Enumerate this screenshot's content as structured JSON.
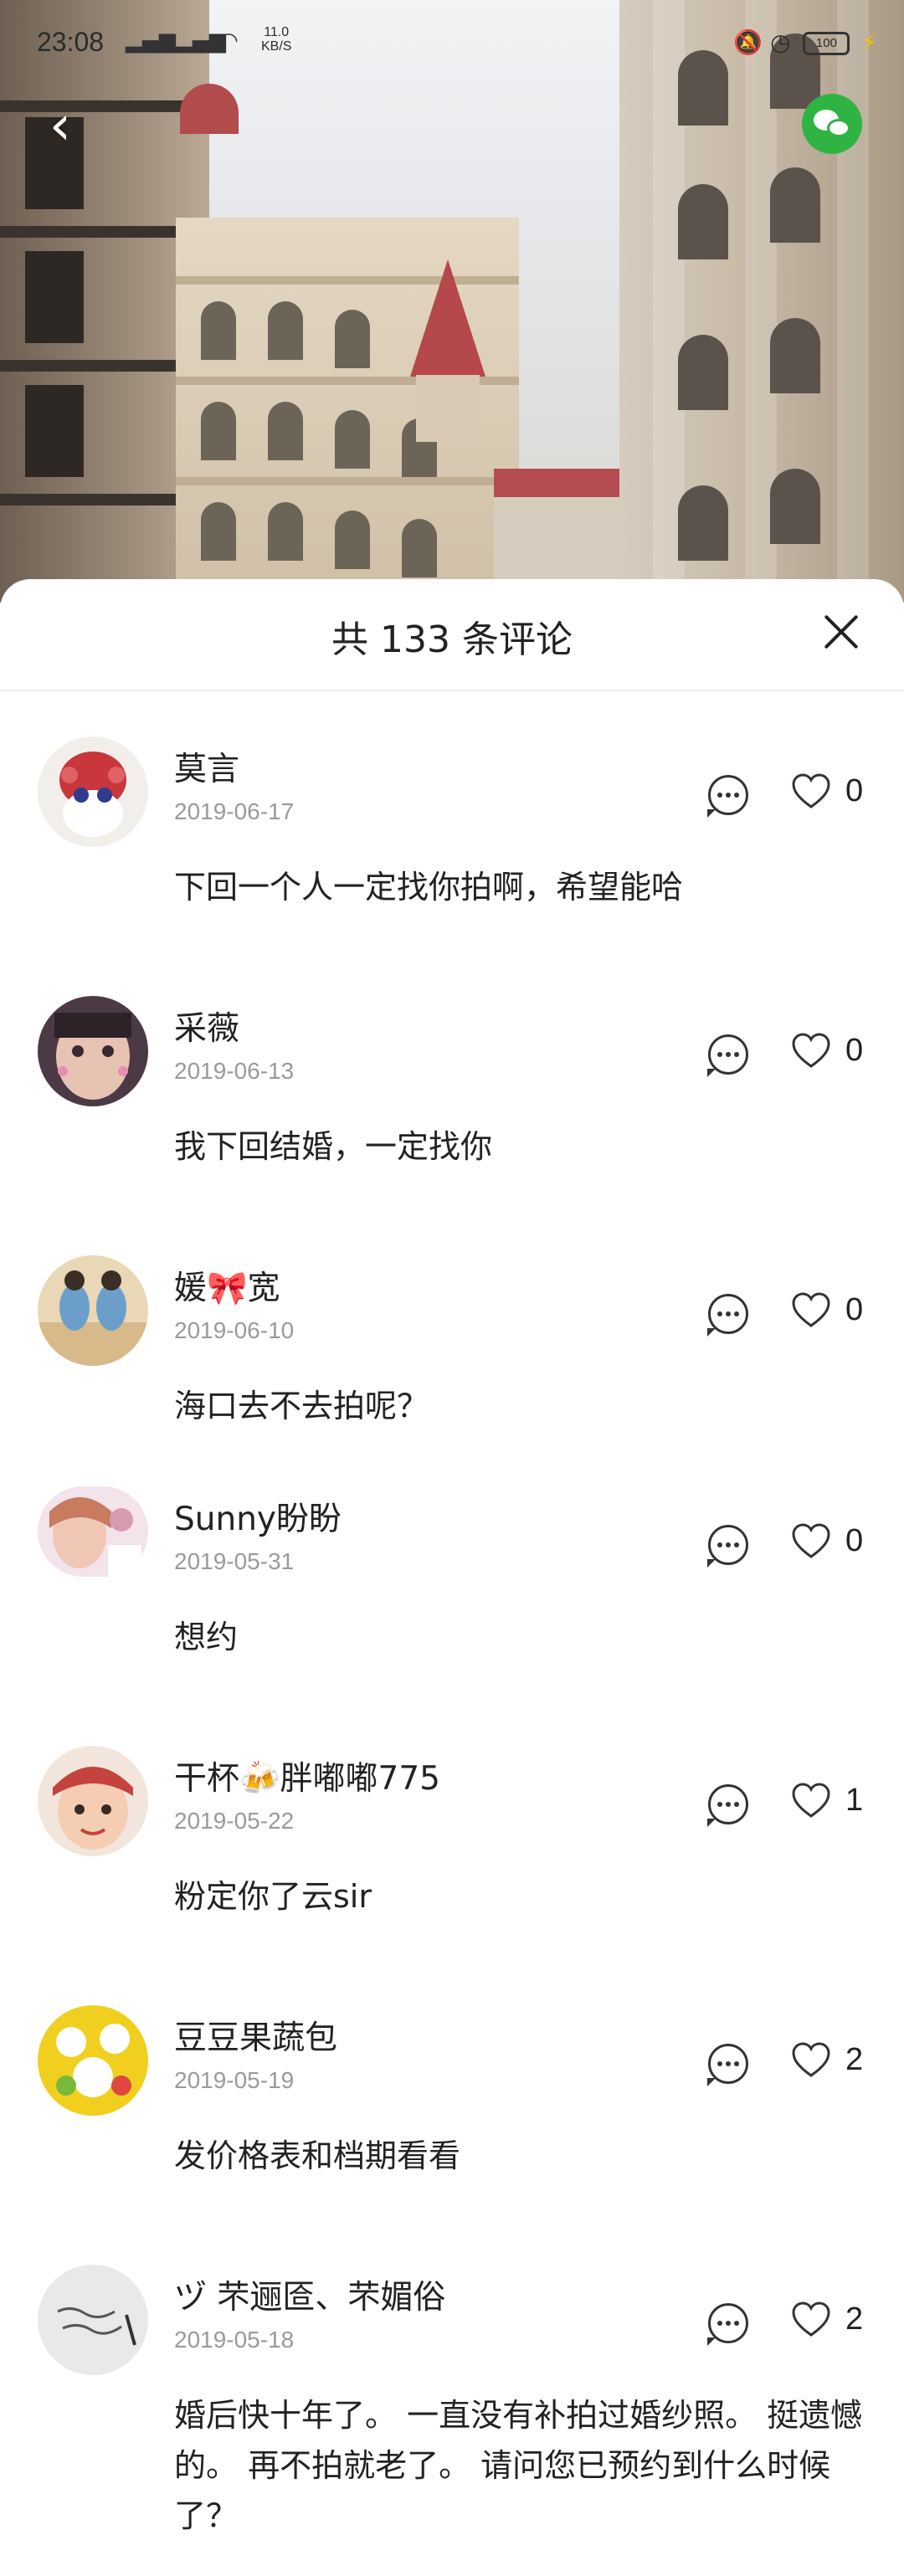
{
  "status_bar": {
    "time": "23:08",
    "network_speed_value": "11.0",
    "network_speed_unit": "KB/S",
    "battery": "100"
  },
  "sheet": {
    "title": "共 133 条评论"
  },
  "comments": [
    {
      "name": "莫言",
      "date": "2019-06-17",
      "likes": "0",
      "text": "下回一个人一定找你拍啊，希望能哈",
      "avatar_color": "#c9363b"
    },
    {
      "name": "采薇",
      "date": "2019-06-13",
      "likes": "0",
      "text": "我下回结婚，一定找你",
      "avatar_color": "#8a6a78"
    },
    {
      "name": "媛🎀宽",
      "date": "2019-06-10",
      "likes": "0",
      "text": "海口去不去拍呢？",
      "avatar_color": "#6b9fc9"
    },
    {
      "name": "Sunny盼盼",
      "date": "2019-05-31",
      "likes": "0",
      "text": "想约",
      "avatar_color": "#d79bb1"
    },
    {
      "name": "干杯🍻胖嘟嘟775",
      "date": "2019-05-22",
      "likes": "1",
      "text": "粉定你了云sir",
      "avatar_color": "#c4433e"
    },
    {
      "name": "豆豆果蔬包",
      "date": "2019-05-19",
      "likes": "2",
      "text": "发价格表和档期看看",
      "avatar_color": "#f1cf1e"
    },
    {
      "name": "ヅ 芣逦匼、芣媚俗",
      "date": "2019-05-18",
      "likes": "2",
      "text": "婚后快十年了。 一直没有补拍过婚纱照。 挺遗憾的。 再不拍就老了。  请问您已预约到什么时候了？",
      "avatar_color": "#e9e9e9"
    }
  ]
}
